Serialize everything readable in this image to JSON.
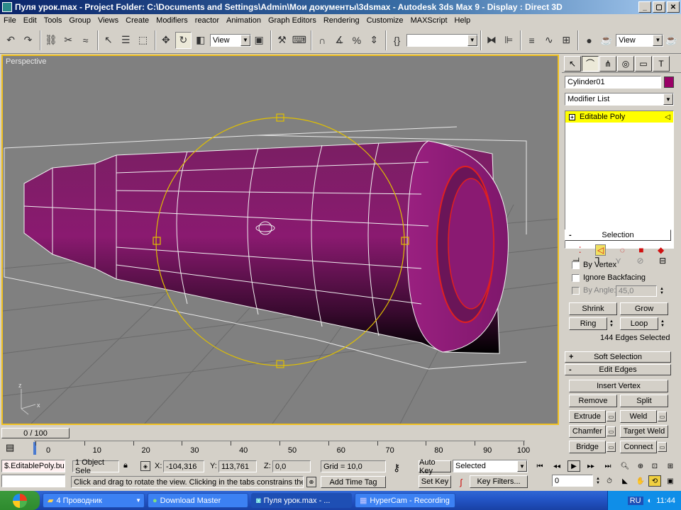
{
  "window": {
    "title": "Пуля урок.max    - Project Folder: C:\\Documents and Settings\\Admin\\Мои документы\\3dsmax    - Autodesk 3ds Max 9    - Display : Direct 3D"
  },
  "menu": [
    "File",
    "Edit",
    "Tools",
    "Group",
    "Views",
    "Create",
    "Modifiers",
    "reactor",
    "Animation",
    "Graph Editors",
    "Rendering",
    "Customize",
    "MAXScript",
    "Help"
  ],
  "toolbar": {
    "view_dropdown": "View",
    "view_dropdown_right": "View"
  },
  "viewport": {
    "label": "Perspective",
    "axis_x": "x",
    "axis_z": "z"
  },
  "command_panel": {
    "object_name": "Cylinder01",
    "object_color": "#990066",
    "modifier_list": "Modifier List",
    "stack_item": "Editable Poly",
    "selection": {
      "title": "Selection",
      "by_vertex": "By Vertex",
      "ignore_backfacing": "Ignore Backfacing",
      "by_angle": "By Angle:",
      "angle_value": "45,0",
      "shrink": "Shrink",
      "grow": "Grow",
      "ring": "Ring",
      "loop": "Loop",
      "selected_info": "144 Edges Selected"
    },
    "soft_selection": "Soft Selection",
    "edit_edges": {
      "title": "Edit Edges",
      "insert_vertex": "Insert Vertex",
      "remove": "Remove",
      "split": "Split",
      "extrude": "Extrude",
      "weld": "Weld",
      "chamfer": "Chamfer",
      "target_weld": "Target Weld",
      "bridge": "Bridge",
      "connect": "Connect"
    }
  },
  "timeline": {
    "frame_display": "0 / 100",
    "ticks": [
      "0",
      "10",
      "20",
      "30",
      "40",
      "50",
      "60",
      "70",
      "80",
      "90",
      "100"
    ]
  },
  "status": {
    "script_listener": "$.EditablePoly.bu",
    "object_count": "1 Object Sele",
    "x_label": "X:",
    "x_value": "-104,316",
    "y_label": "Y:",
    "y_value": "113,761",
    "z_label": "Z:",
    "z_value": "0,0",
    "grid": "Grid = 10,0",
    "prompt": "Click and drag to rotate the view.  Clicking in the tabs constrains the rota",
    "add_time_tag": "Add Time Tag",
    "auto_key": "Auto Key",
    "selected": "Selected",
    "set_key": "Set Key",
    "key_filters": "Key Filters...",
    "frame": "0"
  },
  "taskbar": {
    "items": [
      "4 Проводник",
      "Download Master",
      "Пуля урок.max    - ...",
      "HyperCam - Recording"
    ],
    "lang": "RU",
    "clock": "11:44"
  }
}
